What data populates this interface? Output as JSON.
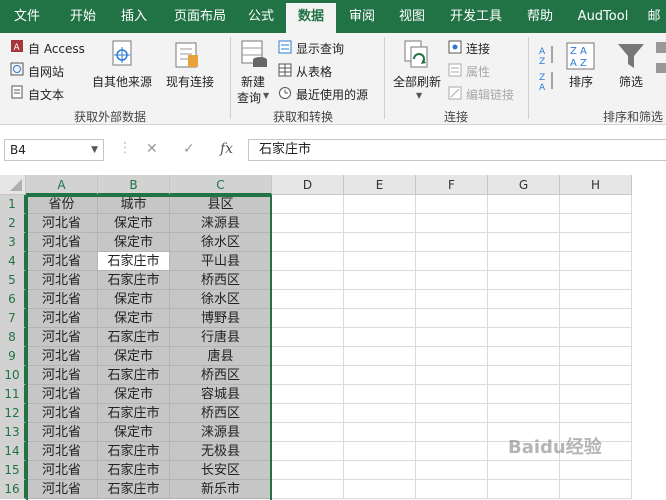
{
  "ribbon_tabs": [
    "文件",
    "开始",
    "插入",
    "页面布局",
    "公式",
    "数据",
    "审阅",
    "视图",
    "开发工具",
    "帮助",
    "AudTool",
    "邮"
  ],
  "active_tab_index": 5,
  "get_external_data": {
    "access": "自 Access",
    "web": "自网站",
    "text": "自文本",
    "other_sources": "自其他来源",
    "existing_connections": "现有连接",
    "group_label": "获取外部数据"
  },
  "get_transform": {
    "new_query_line1": "新建",
    "new_query_line2": "查询",
    "show_queries": "显示查询",
    "from_table": "从表格",
    "recent_sources": "最近使用的源",
    "group_label": "获取和转换"
  },
  "connections": {
    "refresh_all": "全部刷新",
    "connections": "连接",
    "properties": "属性",
    "edit_links": "编辑链接",
    "group_label": "连接"
  },
  "sort_filter": {
    "sort": "排序",
    "filter": "筛选",
    "group_label": "排序和筛选"
  },
  "formula_bar": {
    "name_box": "B4",
    "cancel_glyph": "✕",
    "enter_glyph": "✓",
    "fx_label": "fx",
    "content": "石家庄市"
  },
  "sheet": {
    "columns": [
      "A",
      "B",
      "C",
      "D",
      "E",
      "F",
      "G",
      "H"
    ],
    "rows": [
      [
        "省份",
        "城市",
        "县区"
      ],
      [
        "河北省",
        "保定市",
        "涞源县"
      ],
      [
        "河北省",
        "保定市",
        "徐水区"
      ],
      [
        "河北省",
        "石家庄市",
        "平山县"
      ],
      [
        "河北省",
        "石家庄市",
        "桥西区"
      ],
      [
        "河北省",
        "保定市",
        "徐水区"
      ],
      [
        "河北省",
        "保定市",
        "博野县"
      ],
      [
        "河北省",
        "石家庄市",
        "行唐县"
      ],
      [
        "河北省",
        "保定市",
        "唐县"
      ],
      [
        "河北省",
        "石家庄市",
        "桥西区"
      ],
      [
        "河北省",
        "保定市",
        "容城县"
      ],
      [
        "河北省",
        "石家庄市",
        "桥西区"
      ],
      [
        "河北省",
        "保定市",
        "涞源县"
      ],
      [
        "河北省",
        "石家庄市",
        "无极县"
      ],
      [
        "河北省",
        "石家庄市",
        "长安区"
      ],
      [
        "河北省",
        "石家庄市",
        "新乐市"
      ]
    ]
  },
  "watermark": "Baidu经验"
}
